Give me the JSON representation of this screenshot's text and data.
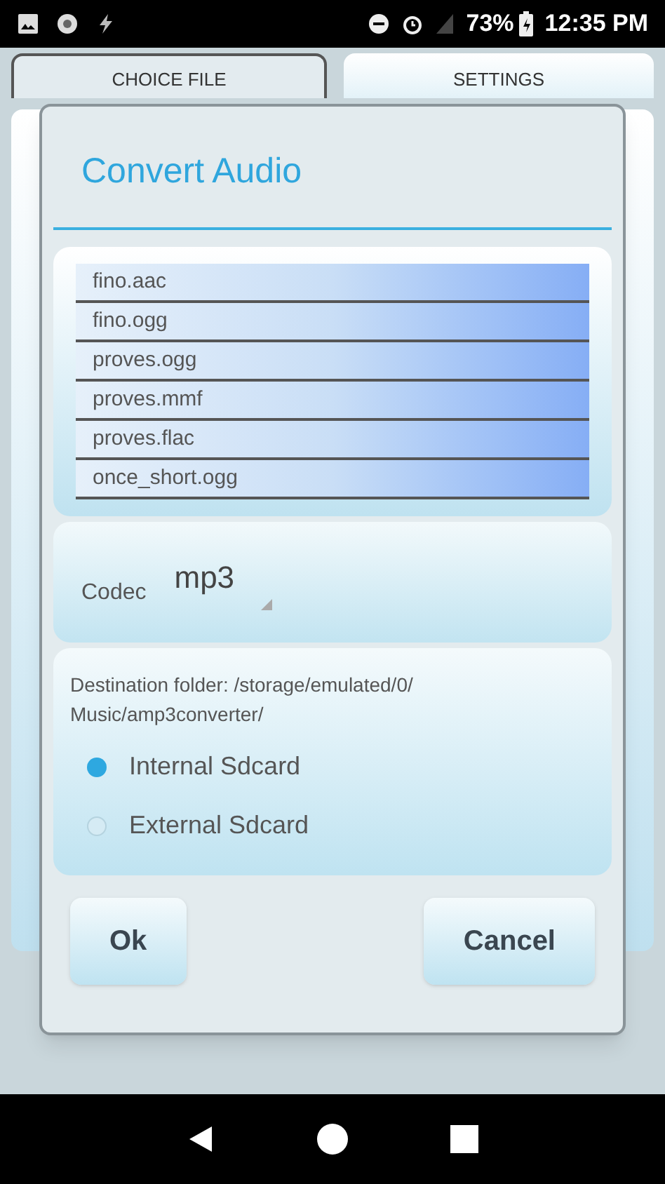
{
  "status_bar": {
    "battery": "73%",
    "time": "12:35 PM"
  },
  "tabs": [
    {
      "label": "CHOICE FILE",
      "selected": true
    },
    {
      "label": "SETTINGS",
      "selected": false
    }
  ],
  "dialog": {
    "title": "Convert Audio",
    "files": [
      "fino.aac",
      "fino.ogg",
      "proves.ogg",
      "proves.mmf",
      "proves.flac",
      "once_short.ogg"
    ],
    "codec": {
      "label": "Codec",
      "value": "mp3"
    },
    "destination": "Destination folder: /storage/emulated/0/ Music/amp3converter/",
    "storage": [
      {
        "label": "Internal Sdcard",
        "selected": true
      },
      {
        "label": "External Sdcard",
        "selected": false
      }
    ],
    "buttons": [
      "Ok",
      "Cancel"
    ]
  }
}
